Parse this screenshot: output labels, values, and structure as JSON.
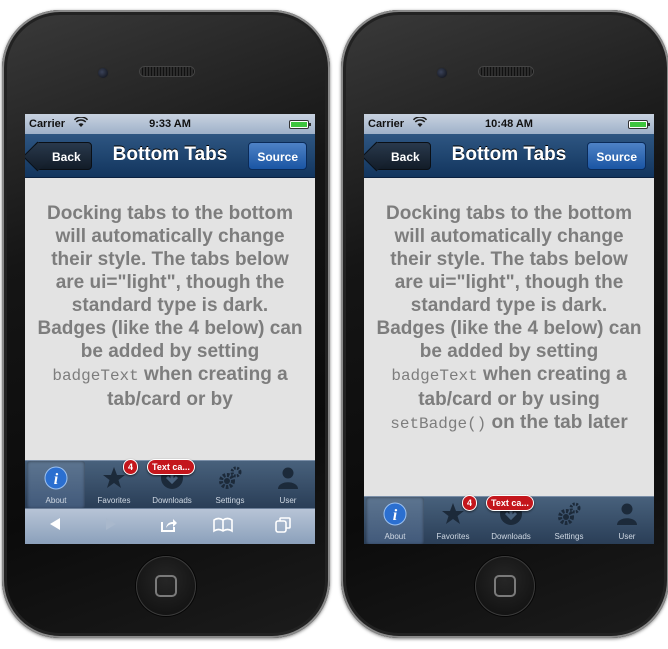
{
  "left": {
    "status": {
      "carrier": "Carrier",
      "time": "9:33 AM"
    },
    "nav": {
      "back_label": "Back",
      "title": "Bottom Tabs",
      "source_label": "Source"
    },
    "content": {
      "part1": "Docking tabs to the bottom will automatically change their style. The tabs below are ui=\"light\", though the standard type is dark. Badges (like the 4 below) can be added by setting",
      "code1": "badgeText",
      "part2": "when creating a tab/card or by"
    },
    "tabs": [
      {
        "label": "About",
        "active": true,
        "icon": "info-icon"
      },
      {
        "label": "Favorites",
        "active": false,
        "icon": "star-icon",
        "badge": "4"
      },
      {
        "label": "Downloads",
        "active": false,
        "icon": "download-icon",
        "badge": "Text ca..."
      },
      {
        "label": "Settings",
        "active": false,
        "icon": "gears-icon"
      },
      {
        "label": "User",
        "active": false,
        "icon": "user-icon"
      }
    ],
    "safari_toolbar": [
      "back-arrow-icon",
      "forward-arrow-icon",
      "share-icon",
      "bookmarks-icon",
      "tabs-icon"
    ]
  },
  "right": {
    "status": {
      "carrier": "Carrier",
      "time": "10:48 AM"
    },
    "nav": {
      "back_label": "Back",
      "title": "Bottom Tabs",
      "source_label": "Source"
    },
    "content": {
      "part1": "Docking tabs to the bottom will automatically change their style. The tabs below are ui=\"light\", though the standard type is dark. Badges (like the 4 below) can be added by setting",
      "code1": "badgeText",
      "part2": "when creating a tab/card or by using",
      "code2": "setBadge()",
      "part3": "on the tab later"
    },
    "tabs": [
      {
        "label": "About",
        "active": true,
        "icon": "info-icon"
      },
      {
        "label": "Favorites",
        "active": false,
        "icon": "star-icon",
        "badge": "4"
      },
      {
        "label": "Downloads",
        "active": false,
        "icon": "download-icon",
        "badge": "Text ca..."
      },
      {
        "label": "Settings",
        "active": false,
        "icon": "gears-icon"
      },
      {
        "label": "User",
        "active": false,
        "icon": "user-icon"
      }
    ]
  },
  "colors": {
    "navbar": "#1d4470",
    "tabbar": "#3a5069",
    "badge": "#c4161c",
    "content_bg": "#e3e3e3",
    "content_text": "#7d7d7d"
  }
}
